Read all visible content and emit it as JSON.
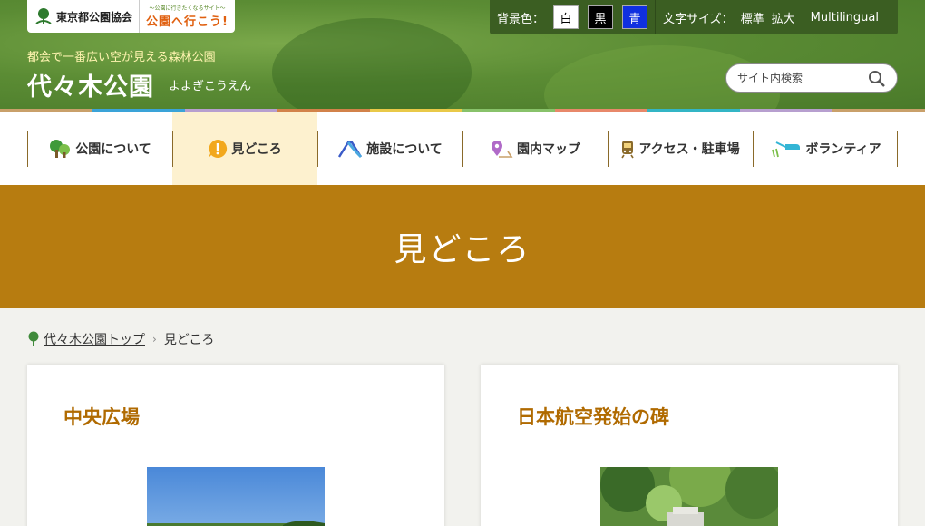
{
  "header": {
    "org_logo_text": "東京都公園協会",
    "campaign_logo_small": "〜公園に行きたくなるサイト〜",
    "campaign_logo_big": "公園へ行こう!",
    "tagline": "都会で一番広い空が見える森林公園",
    "site_title": "代々木公園",
    "site_title_kana": "よよぎこうえん"
  },
  "controls": {
    "bg_label": "背景色：",
    "bg_white": "白",
    "bg_black": "黒",
    "bg_blue": "青",
    "font_label": "文字サイズ：",
    "font_standard": "標準",
    "font_large": "拡大",
    "multilingual": "Multilingual"
  },
  "search": {
    "placeholder": "サイト内検索"
  },
  "strip_colors": [
    "#c9a06a",
    "#3aa3d8",
    "#b79fcf",
    "#d2824a",
    "#e9c948",
    "#88c26a",
    "#e8886a",
    "#33b5c5",
    "#b79fcf",
    "#c9a06a"
  ],
  "nav": {
    "items": [
      {
        "label": "公園について",
        "icon": "tree-icon"
      },
      {
        "label": "見どころ",
        "icon": "exclamation-bubble-icon"
      },
      {
        "label": "施設について",
        "icon": "slide-icon"
      },
      {
        "label": "園内マップ",
        "icon": "map-pin-icon"
      },
      {
        "label": "アクセス・駐車場",
        "icon": "train-icon"
      },
      {
        "label": "ボランティア",
        "icon": "watering-can-icon"
      }
    ]
  },
  "banner": {
    "title": "見どころ"
  },
  "breadcrumb": {
    "home": "代々木公園トップ",
    "current": "見どころ"
  },
  "cards": [
    {
      "title": "中央広場"
    },
    {
      "title": "日本航空発始の碑"
    }
  ],
  "colors": {
    "accent": "#b77c10",
    "header_green": "#5b8c34",
    "title_orange": "#b06a00"
  }
}
